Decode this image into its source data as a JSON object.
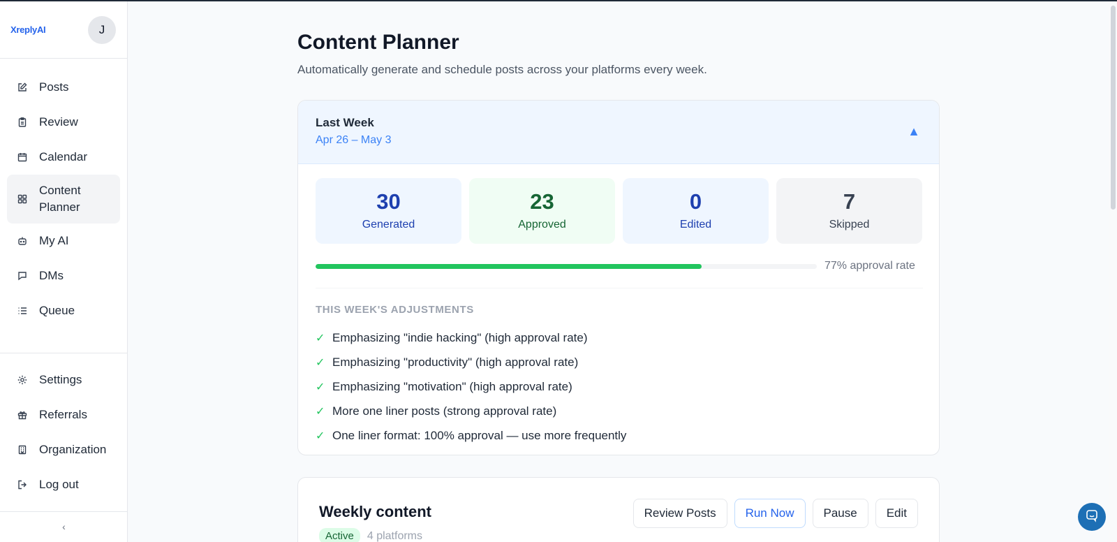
{
  "app": {
    "logo": "XreplyAI",
    "avatar_initial": "J"
  },
  "sidebar": {
    "items": [
      {
        "label": "Posts",
        "icon": "edit-icon"
      },
      {
        "label": "Review",
        "icon": "clipboard-icon"
      },
      {
        "label": "Calendar",
        "icon": "calendar-icon"
      },
      {
        "label": "Content Planner",
        "icon": "grid-icon",
        "active": true
      },
      {
        "label": "My AI",
        "icon": "robot-icon"
      },
      {
        "label": "DMs",
        "icon": "chat-bubble-icon"
      },
      {
        "label": "Queue",
        "icon": "list-icon"
      }
    ],
    "bottom_items": [
      {
        "label": "Settings",
        "icon": "gear-icon"
      },
      {
        "label": "Referrals",
        "icon": "gift-icon"
      },
      {
        "label": "Organization",
        "icon": "building-icon"
      },
      {
        "label": "Log out",
        "icon": "logout-icon"
      }
    ],
    "collapse_glyph": "‹"
  },
  "page": {
    "title": "Content Planner",
    "subtitle": "Automatically generate and schedule posts across your platforms every week."
  },
  "last_week": {
    "title": "Last Week",
    "range": "Apr 26 – May 3",
    "toggle_glyph": "▲",
    "stats": {
      "generated": {
        "value": "30",
        "label": "Generated"
      },
      "approved": {
        "value": "23",
        "label": "Approved"
      },
      "edited": {
        "value": "0",
        "label": "Edited"
      },
      "skipped": {
        "value": "7",
        "label": "Skipped"
      }
    },
    "approval_rate": 77,
    "approval_text": "77% approval rate",
    "adjustments_title": "THIS WEEK'S ADJUSTMENTS",
    "adjustments": [
      "Emphasizing \"indie hacking\" (high approval rate)",
      "Emphasizing \"productivity\" (high approval rate)",
      "Emphasizing \"motivation\" (high approval rate)",
      "More one liner posts (strong approval rate)",
      "One liner format: 100% approval — use more frequently"
    ],
    "check_glyph": "✓"
  },
  "weekly": {
    "title": "Weekly content",
    "status": "Active",
    "platforms": "4 platforms",
    "buttons": {
      "review": "Review Posts",
      "run": "Run Now",
      "pause": "Pause",
      "edit": "Edit"
    }
  },
  "colors": {
    "accent": "#2563eb",
    "success": "#22c55e",
    "chat": "#1d6fb5"
  }
}
